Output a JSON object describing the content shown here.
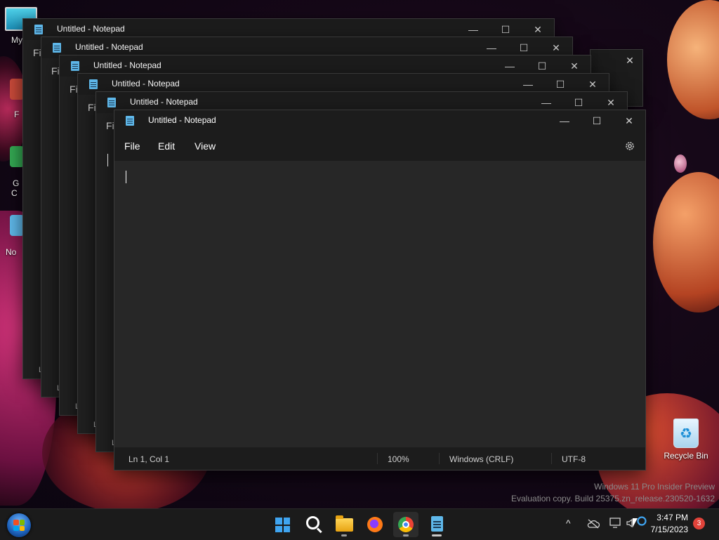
{
  "desktop": {
    "icons": [
      {
        "label": "My C"
      },
      {
        "label": "Recycle Bin"
      }
    ],
    "side_labels": [
      "F",
      "G",
      "C",
      "No"
    ]
  },
  "notepad_windows": [
    {
      "title": "Untitled - Notepad",
      "menu_peek": "Fi",
      "status_peek": "L"
    },
    {
      "title": "Untitled - Notepad",
      "menu_peek": "File",
      "status_peek": "L"
    },
    {
      "title": "Untitled - Notepad",
      "menu_peek": "Fil",
      "status_peek": "L"
    },
    {
      "title": "Untitled - Notepad",
      "menu_peek": "Fil",
      "status_peek": "L"
    },
    {
      "title": "Untitled - Notepad",
      "menu_peek": "Fi",
      "status_peek": "L"
    }
  ],
  "active_window": {
    "title": "Untitled - Notepad",
    "controls": {
      "minimize": "—",
      "maximize": "☐",
      "close": "✕"
    },
    "menu": [
      "File",
      "Edit",
      "View"
    ],
    "settings_icon": "gear-icon",
    "status": {
      "position": "Ln 1, Col 1",
      "zoom": "100%",
      "line_ending": "Windows (CRLF)",
      "encoding": "UTF-8"
    }
  },
  "watermark": {
    "line1": "Windows 11 Pro Insider Preview",
    "line2": "Evaluation copy. Build 25375.zn_release.230520-1632"
  },
  "taskbar": {
    "pinned": [
      "start-orb",
      "windows-start",
      "search",
      "file-explorer",
      "firefox",
      "chrome",
      "notepad"
    ],
    "tray": {
      "chevron": "^",
      "network": "▭",
      "volume": "🔈"
    },
    "clock": {
      "time": "3:47 PM",
      "date": "7/15/2023"
    },
    "notifications": "3"
  },
  "colors": {
    "accent": "#3fa4f0",
    "window_bg": "#202020",
    "editor_bg": "#272727",
    "badge": "#e0433a"
  }
}
